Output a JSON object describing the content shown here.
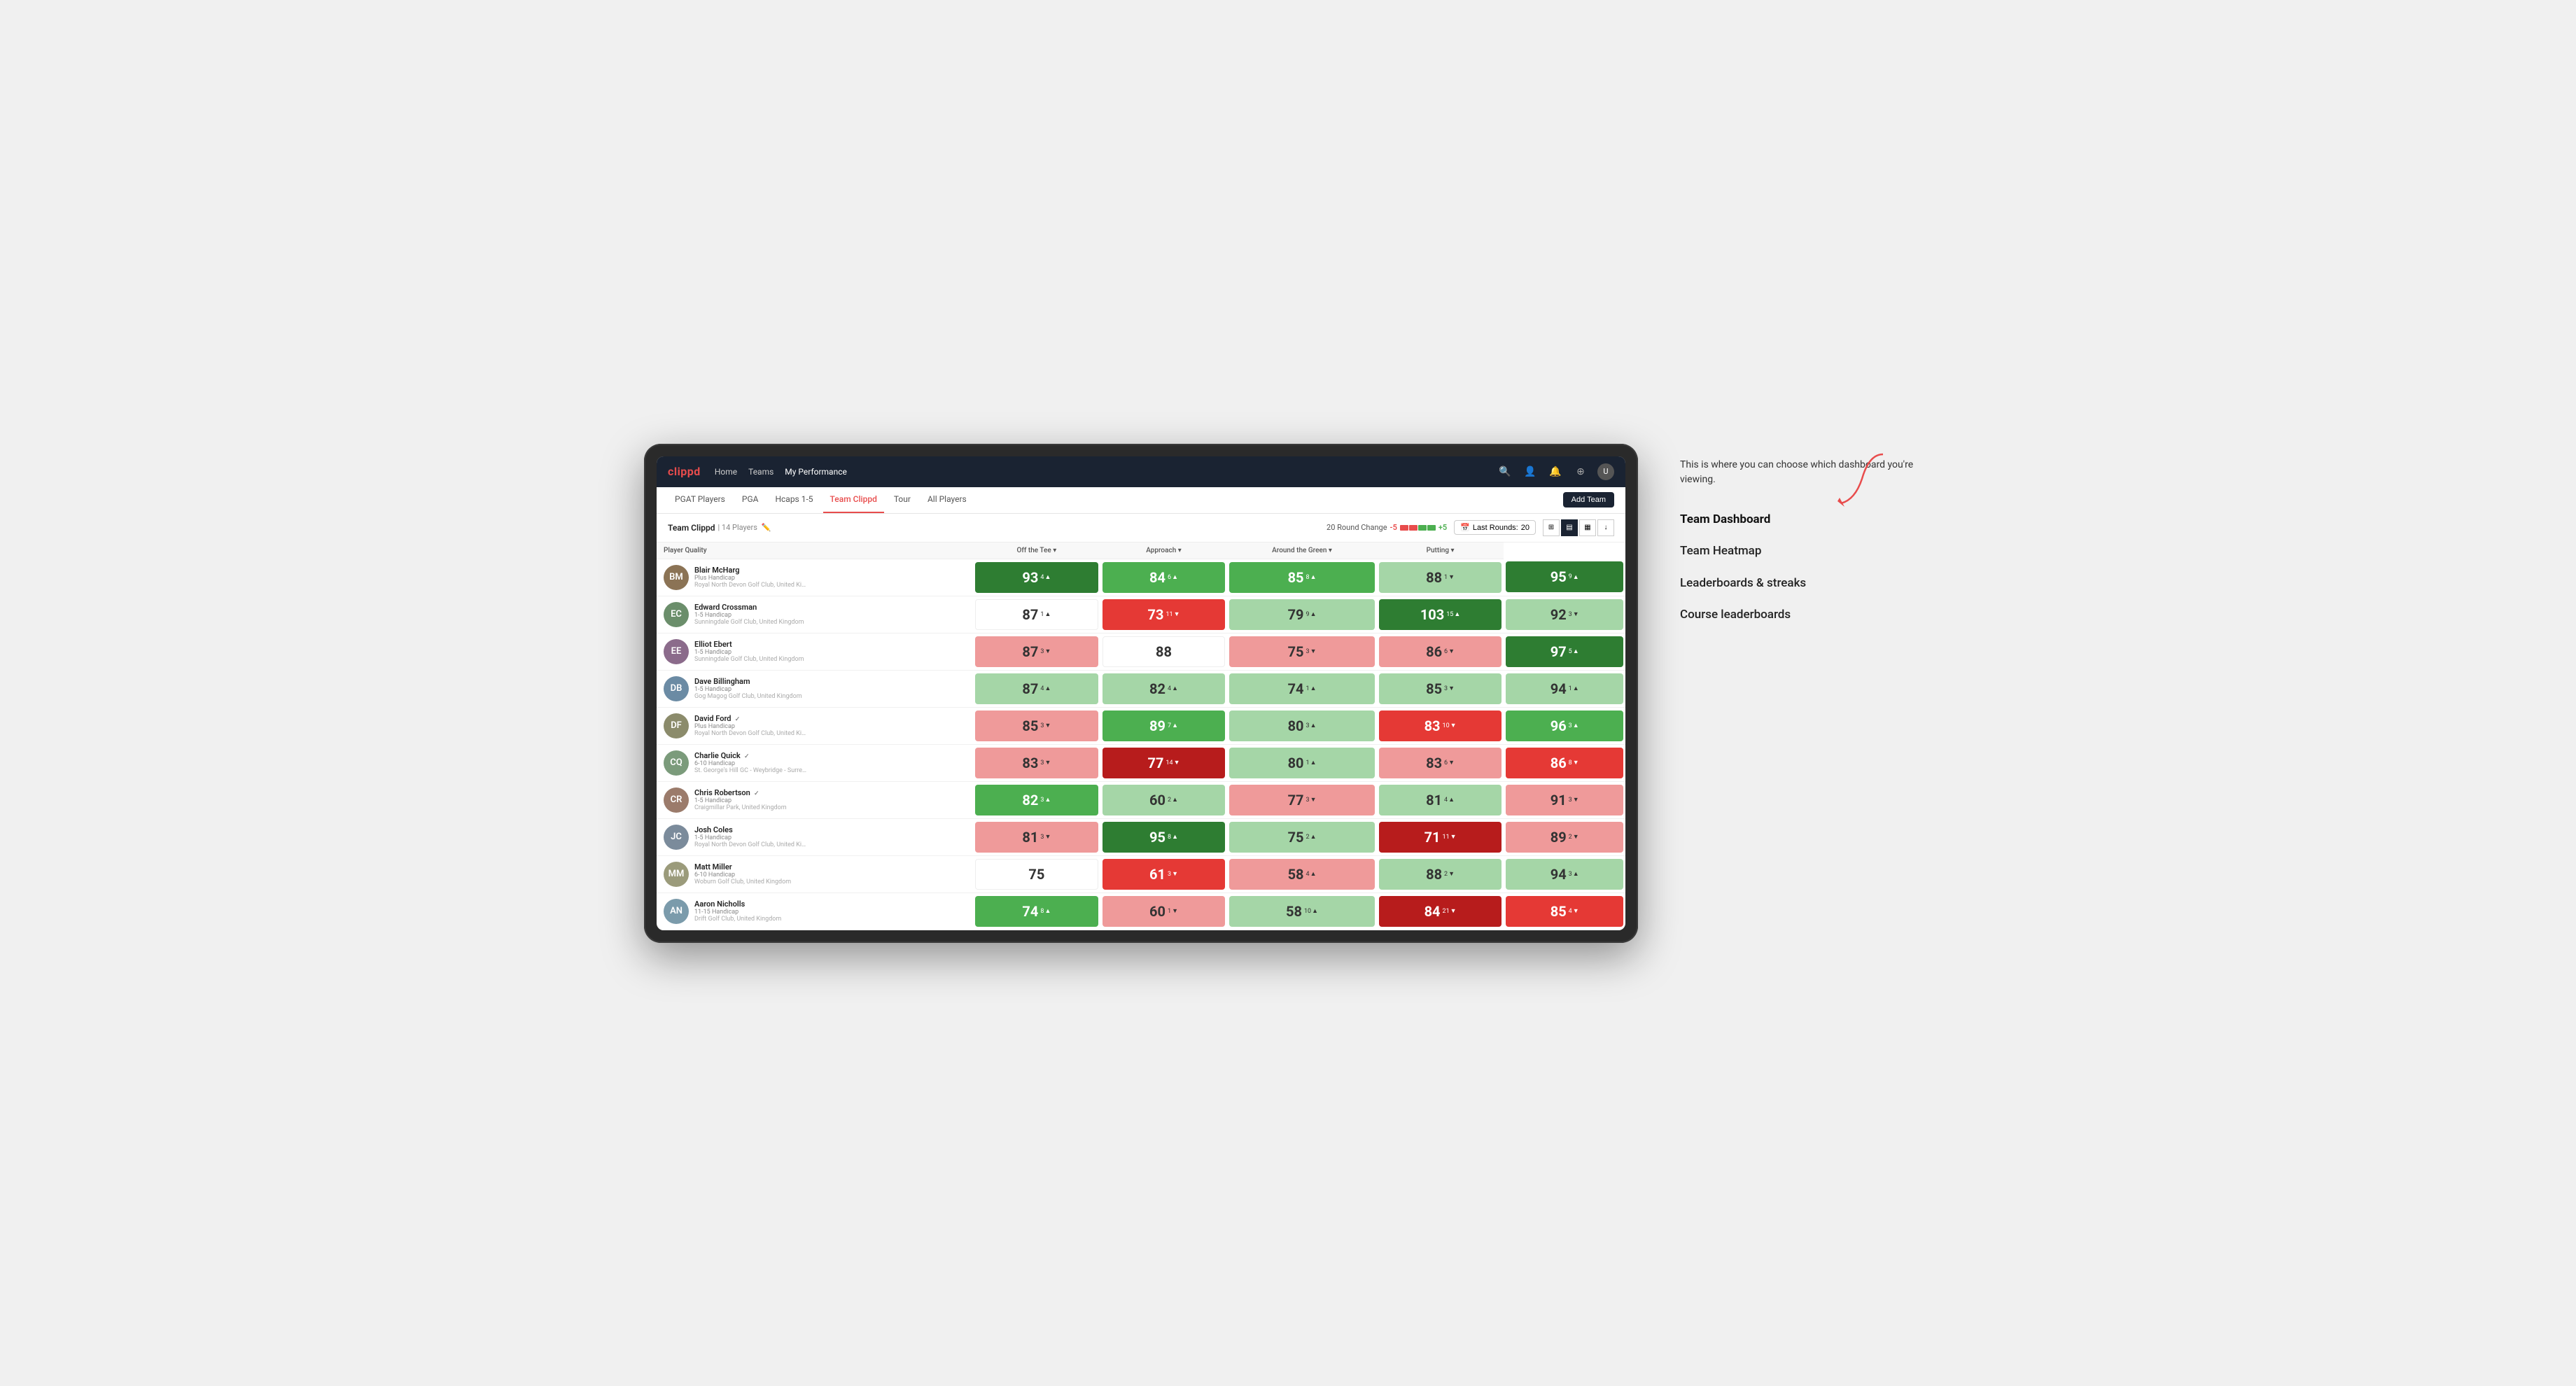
{
  "app": {
    "logo": "clippd",
    "nav": {
      "links": [
        "Home",
        "Teams",
        "My Performance"
      ],
      "active": "My Performance",
      "icons": [
        "search",
        "user",
        "bell",
        "compass",
        "avatar"
      ]
    },
    "subnav": {
      "links": [
        "PGAT Players",
        "PGA",
        "Hcaps 1-5",
        "Team Clippd",
        "Tour",
        "All Players"
      ],
      "active": "Team Clippd",
      "add_button": "Add Team"
    }
  },
  "team": {
    "name": "Team Clippd",
    "count": "14 Players",
    "round_change_label": "20 Round Change",
    "round_change_neg": "-5",
    "round_change_pos": "+5",
    "last_rounds_label": "Last Rounds:",
    "last_rounds_value": "20"
  },
  "table": {
    "columns": {
      "player": "Player Quality",
      "off_tee": "Off the Tee",
      "approach": "Approach",
      "around_green": "Around the Green",
      "putting": "Putting"
    },
    "players": [
      {
        "name": "Blair McHarg",
        "handicap": "Plus Handicap",
        "club": "Royal North Devon Golf Club, United Kingdom",
        "avatar_color": "#8B7355",
        "initials": "BM",
        "scores": {
          "player_quality": {
            "value": 93,
            "change": "+4",
            "dir": "up",
            "bg": "bg-green-strong"
          },
          "off_tee": {
            "value": 84,
            "change": "+6",
            "dir": "up",
            "bg": "bg-green-mid"
          },
          "approach": {
            "value": 85,
            "change": "+8",
            "dir": "up",
            "bg": "bg-green-mid"
          },
          "around_green": {
            "value": 88,
            "change": "-1",
            "dir": "down",
            "bg": "bg-green-light"
          },
          "putting": {
            "value": 95,
            "change": "+9",
            "dir": "up",
            "bg": "bg-green-strong"
          }
        }
      },
      {
        "name": "Edward Crossman",
        "handicap": "1-5 Handicap",
        "club": "Sunningdale Golf Club, United Kingdom",
        "avatar_color": "#6B8E6B",
        "initials": "EC",
        "scores": {
          "player_quality": {
            "value": 87,
            "change": "+1",
            "dir": "up",
            "bg": "bg-white"
          },
          "off_tee": {
            "value": 73,
            "change": "-11",
            "dir": "down",
            "bg": "bg-red-mid"
          },
          "approach": {
            "value": 79,
            "change": "+9",
            "dir": "up",
            "bg": "bg-green-light"
          },
          "around_green": {
            "value": 103,
            "change": "+15",
            "dir": "up",
            "bg": "bg-green-strong"
          },
          "putting": {
            "value": 92,
            "change": "-3",
            "dir": "down",
            "bg": "bg-green-light"
          }
        }
      },
      {
        "name": "Elliot Ebert",
        "handicap": "1-5 Handicap",
        "club": "Sunningdale Golf Club, United Kingdom",
        "avatar_color": "#8B6B8B",
        "initials": "EE",
        "scores": {
          "player_quality": {
            "value": 87,
            "change": "-3",
            "dir": "down",
            "bg": "bg-red-light"
          },
          "off_tee": {
            "value": 88,
            "change": "",
            "dir": "",
            "bg": "bg-white"
          },
          "approach": {
            "value": 75,
            "change": "-3",
            "dir": "down",
            "bg": "bg-red-light"
          },
          "around_green": {
            "value": 86,
            "change": "-6",
            "dir": "down",
            "bg": "bg-red-light"
          },
          "putting": {
            "value": 97,
            "change": "+5",
            "dir": "up",
            "bg": "bg-green-strong"
          }
        }
      },
      {
        "name": "Dave Billingham",
        "handicap": "1-5 Handicap",
        "club": "Gog Magog Golf Club, United Kingdom",
        "avatar_color": "#6B8BA4",
        "initials": "DB",
        "scores": {
          "player_quality": {
            "value": 87,
            "change": "+4",
            "dir": "up",
            "bg": "bg-green-light"
          },
          "off_tee": {
            "value": 82,
            "change": "+4",
            "dir": "up",
            "bg": "bg-green-light"
          },
          "approach": {
            "value": 74,
            "change": "+1",
            "dir": "up",
            "bg": "bg-green-light"
          },
          "around_green": {
            "value": 85,
            "change": "-3",
            "dir": "down",
            "bg": "bg-green-light"
          },
          "putting": {
            "value": 94,
            "change": "+1",
            "dir": "up",
            "bg": "bg-green-light"
          }
        }
      },
      {
        "name": "David Ford",
        "handicap": "Plus Handicap",
        "club": "Royal North Devon Golf Club, United Kingdom",
        "avatar_color": "#8B8B6B",
        "initials": "DF",
        "verified": true,
        "scores": {
          "player_quality": {
            "value": 85,
            "change": "-3",
            "dir": "down",
            "bg": "bg-red-light"
          },
          "off_tee": {
            "value": 89,
            "change": "+7",
            "dir": "up",
            "bg": "bg-green-mid"
          },
          "approach": {
            "value": 80,
            "change": "+3",
            "dir": "up",
            "bg": "bg-green-light"
          },
          "around_green": {
            "value": 83,
            "change": "-10",
            "dir": "down",
            "bg": "bg-red-mid"
          },
          "putting": {
            "value": 96,
            "change": "+3",
            "dir": "up",
            "bg": "bg-green-mid"
          }
        }
      },
      {
        "name": "Charlie Quick",
        "handicap": "6-10 Handicap",
        "club": "St. George's Hill GC - Weybridge - Surrey, Uni...",
        "avatar_color": "#7B9B7B",
        "initials": "CQ",
        "verified": true,
        "scores": {
          "player_quality": {
            "value": 83,
            "change": "-3",
            "dir": "down",
            "bg": "bg-red-light"
          },
          "off_tee": {
            "value": 77,
            "change": "-14",
            "dir": "down",
            "bg": "bg-red-strong"
          },
          "approach": {
            "value": 80,
            "change": "+1",
            "dir": "up",
            "bg": "bg-green-light"
          },
          "around_green": {
            "value": 83,
            "change": "-6",
            "dir": "down",
            "bg": "bg-red-light"
          },
          "putting": {
            "value": 86,
            "change": "-8",
            "dir": "down",
            "bg": "bg-red-mid"
          }
        }
      },
      {
        "name": "Chris Robertson",
        "handicap": "1-5 Handicap",
        "club": "Craigmillar Park, United Kingdom",
        "avatar_color": "#9B7B6B",
        "initials": "CR",
        "verified": true,
        "scores": {
          "player_quality": {
            "value": 82,
            "change": "+3",
            "dir": "up",
            "bg": "bg-green-mid"
          },
          "off_tee": {
            "value": 60,
            "change": "+2",
            "dir": "up",
            "bg": "bg-green-light"
          },
          "approach": {
            "value": 77,
            "change": "-3",
            "dir": "down",
            "bg": "bg-red-light"
          },
          "around_green": {
            "value": 81,
            "change": "+4",
            "dir": "up",
            "bg": "bg-green-light"
          },
          "putting": {
            "value": 91,
            "change": "-3",
            "dir": "down",
            "bg": "bg-red-light"
          }
        }
      },
      {
        "name": "Josh Coles",
        "handicap": "1-5 Handicap",
        "club": "Royal North Devon Golf Club, United Kingdom",
        "avatar_color": "#7B8B9B",
        "initials": "JC",
        "scores": {
          "player_quality": {
            "value": 81,
            "change": "-3",
            "dir": "down",
            "bg": "bg-red-light"
          },
          "off_tee": {
            "value": 95,
            "change": "+8",
            "dir": "up",
            "bg": "bg-green-strong"
          },
          "approach": {
            "value": 75,
            "change": "+2",
            "dir": "up",
            "bg": "bg-green-light"
          },
          "around_green": {
            "value": 71,
            "change": "-11",
            "dir": "down",
            "bg": "bg-red-strong"
          },
          "putting": {
            "value": 89,
            "change": "-2",
            "dir": "down",
            "bg": "bg-red-light"
          }
        }
      },
      {
        "name": "Matt Miller",
        "handicap": "6-10 Handicap",
        "club": "Woburn Golf Club, United Kingdom",
        "avatar_color": "#9B9B7B",
        "initials": "MM",
        "scores": {
          "player_quality": {
            "value": 75,
            "change": "",
            "dir": "",
            "bg": "bg-white"
          },
          "off_tee": {
            "value": 61,
            "change": "-3",
            "dir": "down",
            "bg": "bg-red-mid"
          },
          "approach": {
            "value": 58,
            "change": "+4",
            "dir": "up",
            "bg": "bg-red-light"
          },
          "around_green": {
            "value": 88,
            "change": "-2",
            "dir": "down",
            "bg": "bg-green-light"
          },
          "putting": {
            "value": 94,
            "change": "+3",
            "dir": "up",
            "bg": "bg-green-light"
          }
        }
      },
      {
        "name": "Aaron Nicholls",
        "handicap": "11-15 Handicap",
        "club": "Drift Golf Club, United Kingdom",
        "avatar_color": "#7B9BAB",
        "initials": "AN",
        "scores": {
          "player_quality": {
            "value": 74,
            "change": "+8",
            "dir": "up",
            "bg": "bg-green-mid"
          },
          "off_tee": {
            "value": 60,
            "change": "-1",
            "dir": "down",
            "bg": "bg-red-light"
          },
          "approach": {
            "value": 58,
            "change": "+10",
            "dir": "up",
            "bg": "bg-green-light"
          },
          "around_green": {
            "value": 84,
            "change": "-21",
            "dir": "down",
            "bg": "bg-red-strong"
          },
          "putting": {
            "value": 85,
            "change": "-4",
            "dir": "down",
            "bg": "bg-red-mid"
          }
        }
      }
    ]
  },
  "annotation": {
    "text": "This is where you can choose which dashboard you're viewing.",
    "menu_items": [
      {
        "label": "Team Dashboard",
        "active": true
      },
      {
        "label": "Team Heatmap",
        "active": false
      },
      {
        "label": "Leaderboards & streaks",
        "active": false
      },
      {
        "label": "Course leaderboards",
        "active": false
      }
    ]
  }
}
